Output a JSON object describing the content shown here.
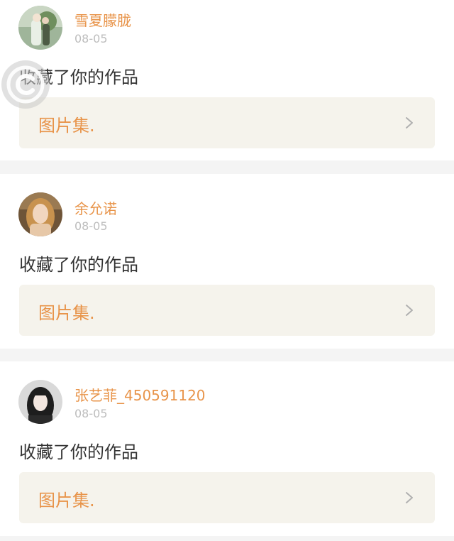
{
  "feed": {
    "items": [
      {
        "username": "雪夏朦胧",
        "time": "08-05",
        "action": "收藏了你的作品",
        "work_title": "图片集."
      },
      {
        "username": "余允诺",
        "time": "08-05",
        "action": "收藏了你的作品",
        "work_title": "图片集."
      },
      {
        "username": "张艺菲_450591120",
        "time": "08-05",
        "action": "收藏了你的作品",
        "work_title": "图片集."
      }
    ]
  },
  "colors": {
    "accent": "#e8944a",
    "text": "#333333",
    "muted": "#bdbdbd",
    "box": "#f5f3ec",
    "background": "#f4f4f4"
  },
  "icons": {
    "chevron": "chevron-right-icon",
    "watermark": "watermark-logo-icon"
  }
}
